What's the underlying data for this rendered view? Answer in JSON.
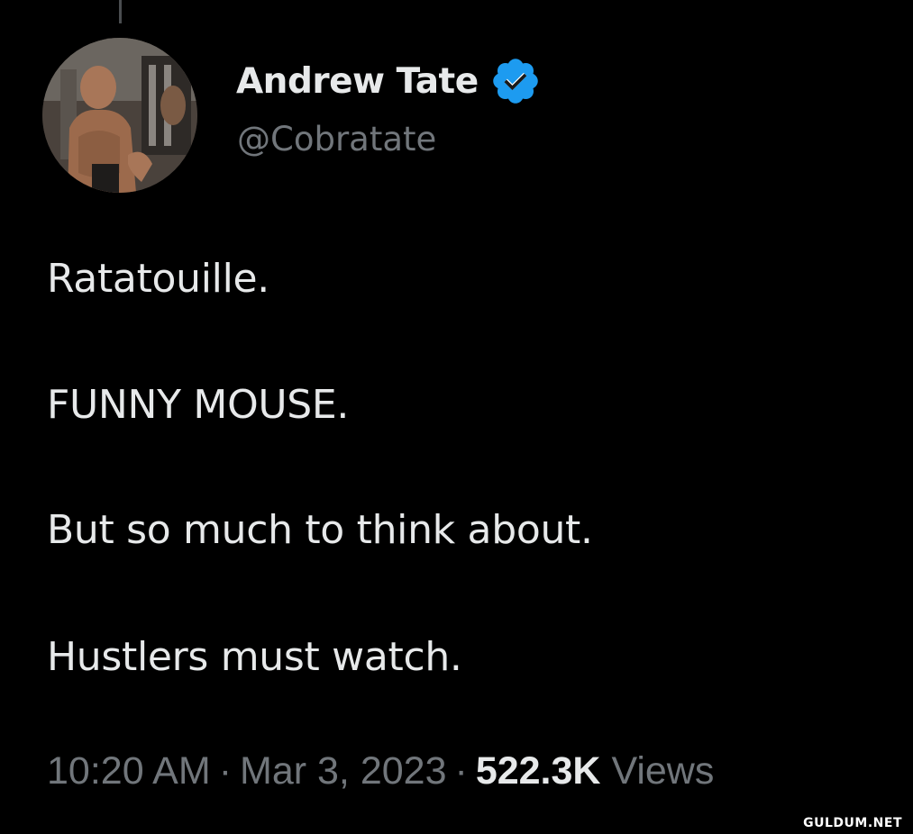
{
  "tweet": {
    "author": {
      "display_name": "Andrew Tate",
      "handle": "@Cobratate",
      "verified": true,
      "verified_icon": "verified-badge-icon",
      "verified_color": "#1d9bf0",
      "avatar_icon": "profile-photo"
    },
    "lines": [
      "Ratatouille.",
      "FUNNY MOUSE.",
      "But so much to think about.",
      "Hustlers must watch."
    ],
    "time": "10:20 AM",
    "separator": "·",
    "date": "Mar 3, 2023",
    "views_count": "522.3K",
    "views_label": "Views"
  },
  "watermark": "GULDUM.NET",
  "colors": {
    "background": "#000000",
    "primary_text": "#e7e9ea",
    "secondary_text": "#71767b"
  }
}
